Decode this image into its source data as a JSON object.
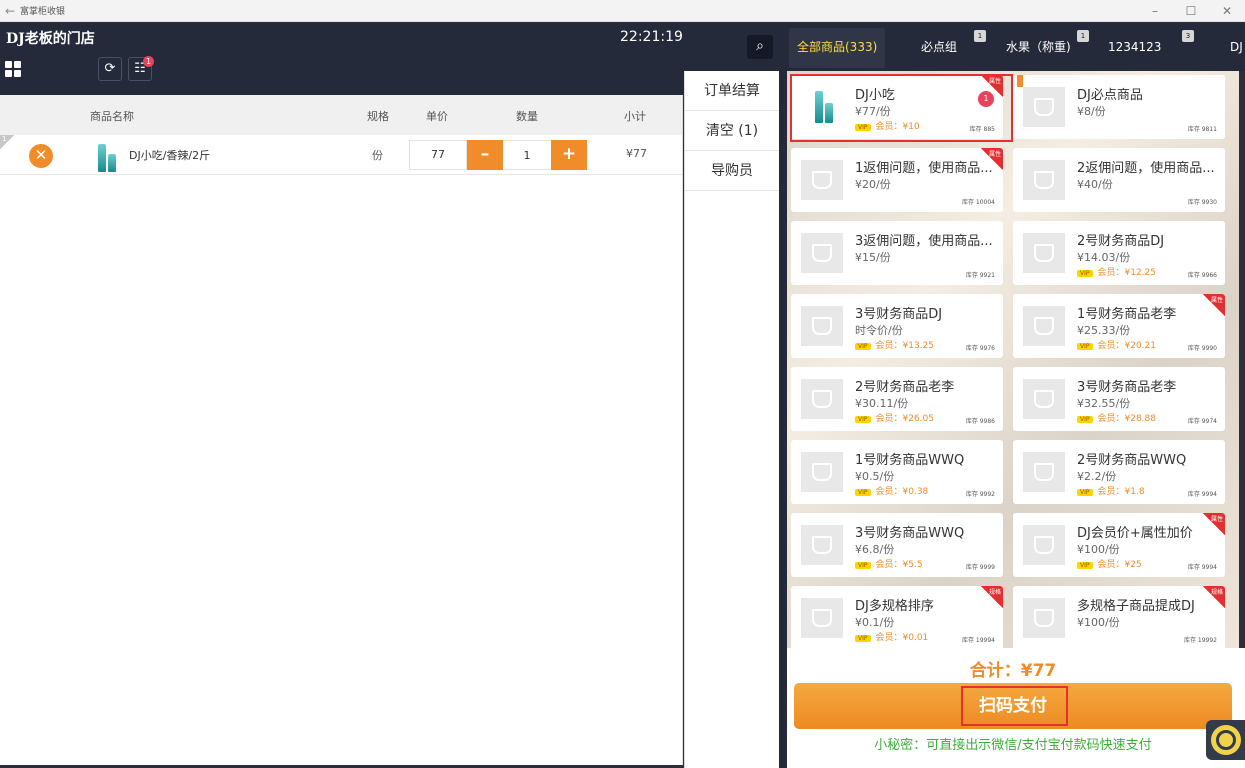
{
  "window": {
    "title": "富掌柜收银",
    "back_icon": "←",
    "minimize": "–",
    "maximize": "☐",
    "close": "✕"
  },
  "header": {
    "store_name": "DJ老板的门店",
    "time": "22:21:19",
    "refresh_icon": "refresh-icon",
    "web_icon": "globe-icon",
    "web_badge": "1",
    "grid_icon": "grid-icon"
  },
  "cart": {
    "columns": {
      "name": "商品名称",
      "spec": "规格",
      "unit_price": "单价",
      "qty": "数量",
      "subtotal": "小计"
    },
    "items": [
      {
        "index": "1",
        "remove_icon": "✕",
        "name": "DJ小吃/香辣/2斤",
        "spec": "份",
        "price": "77",
        "minus": "–",
        "qty": "1",
        "plus": "+",
        "subtotal": "¥77"
      }
    ]
  },
  "actions": {
    "checkout": "订单结算",
    "clear": "清空 (1)",
    "guide": "导购员"
  },
  "categories": {
    "search_icon": "⌕",
    "items": [
      {
        "label": "全部商品(333)"
      },
      {
        "label": "必点组",
        "badge": "1"
      },
      {
        "label": "水果（称重)",
        "badge": "1"
      },
      {
        "label": "1234123",
        "badge": "3"
      },
      {
        "label": "DJ"
      }
    ]
  },
  "goods": [
    {
      "name": "DJ小吃",
      "price": "¥77/份",
      "member": "会员：¥10",
      "stock": "库存 885",
      "tag": "属性",
      "cart_count": "1"
    },
    {
      "name": "DJ必点商品",
      "price": "¥8/份",
      "stock": "库存 9811"
    },
    {
      "name": "1返佣问题，使用商品...",
      "price": "¥20/份",
      "stock": "库存 10004",
      "tag": "属性"
    },
    {
      "name": "2返佣问题，使用商品...",
      "price": "¥40/份",
      "stock": "库存 9930"
    },
    {
      "name": "3返佣问题，使用商品...",
      "price": "¥15/份",
      "stock": "库存 9921"
    },
    {
      "name": "2号财务商品DJ",
      "price": "¥14.03/份",
      "member": "会员：¥12.25",
      "stock": "库存 9966"
    },
    {
      "name": "3号财务商品DJ",
      "price": "时令价/份",
      "member": "会员：¥13.25",
      "stock": "库存 9976"
    },
    {
      "name": "1号财务商品老李",
      "price": "¥25.33/份",
      "member": "会员：¥20.21",
      "stock": "库存 9990",
      "tag": "属性"
    },
    {
      "name": "2号财务商品老李",
      "price": "¥30.11/份",
      "member": "会员：¥26.05",
      "stock": "库存 9986"
    },
    {
      "name": "3号财务商品老李",
      "price": "¥32.55/份",
      "member": "会员：¥28.88",
      "stock": "库存 9974"
    },
    {
      "name": "1号财务商品WWQ",
      "price": "¥0.5/份",
      "member": "会员：¥0.38",
      "stock": "库存 9992"
    },
    {
      "name": "2号财务商品WWQ",
      "price": "¥2.2/份",
      "member": "会员：¥1.8",
      "stock": "库存 9994"
    },
    {
      "name": "3号财务商品WWQ",
      "price": "¥6.8/份",
      "member": "会员：¥5.5",
      "stock": "库存 9999"
    },
    {
      "name": "DJ会员价+属性加价",
      "price": "¥100/份",
      "member": "会员：¥25",
      "stock": "库存 9994",
      "tag": "属性"
    },
    {
      "name": "DJ多规格排序",
      "price": "¥0.1/份",
      "member": "会员：¥0.01",
      "stock": "库存 19994",
      "tag": "规格"
    },
    {
      "name": "多规格子商品提成DJ",
      "price": "¥100/份",
      "stock": "库存 19992",
      "tag": "规格"
    }
  ],
  "vip_label": "VIP",
  "footer": {
    "total": "合计：¥77",
    "pay_button": "扫码支付",
    "tip": "小秘密：可直接出示微信/支付宝付款码快速支付"
  },
  "support_icon": "headset-icon",
  "colors": {
    "accent": "#f08c2a",
    "dark_bg": "#252a3a",
    "highlight": "#e53030",
    "tip": "#3cae3c"
  }
}
